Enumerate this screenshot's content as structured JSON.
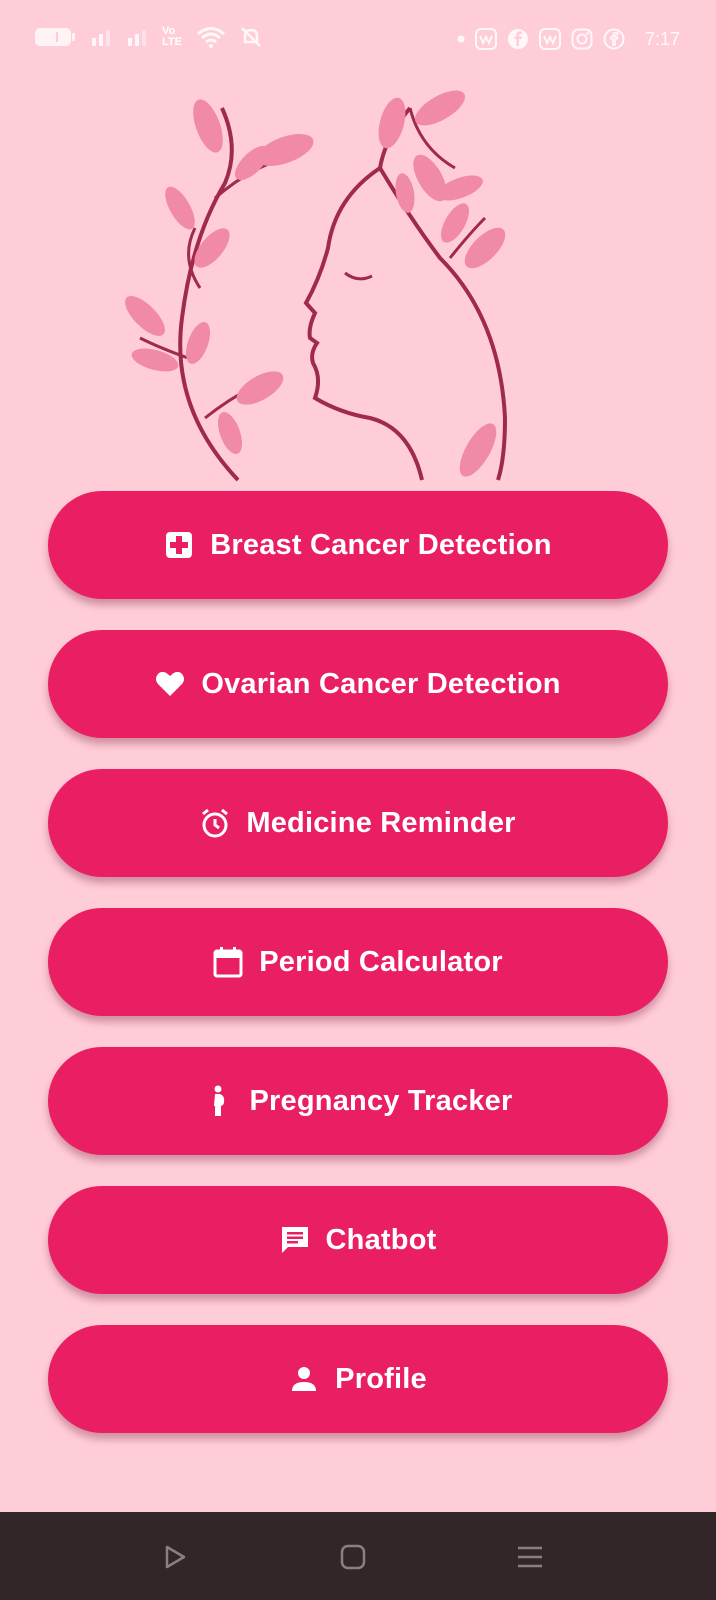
{
  "status_bar": {
    "network_label": "Vo\nLTE",
    "time": "7:17",
    "icons": [
      "battery-icon",
      "signal-icon",
      "signal-icon",
      "volte-icon",
      "wifi-icon",
      "mute-icon",
      "dot-icon",
      "app-icon",
      "facebook-icon",
      "app-icon",
      "instagram-icon",
      "facebook-icon"
    ]
  },
  "hero": {
    "image": "woman-profile-leaves-illustration",
    "colors": {
      "line": "#a0294f",
      "leaf": "#f08aa6"
    }
  },
  "menu": {
    "accent": "#e91e63",
    "items": [
      {
        "label": "Breast Cancer Detection",
        "icon": "medical-cross-icon"
      },
      {
        "label": "Ovarian Cancer Detection",
        "icon": "heart-icon"
      },
      {
        "label": "Medicine Reminder",
        "icon": "alarm-clock-icon"
      },
      {
        "label": "Period Calculator",
        "icon": "calendar-icon"
      },
      {
        "label": "Pregnancy Tracker",
        "icon": "pregnant-woman-icon"
      },
      {
        "label": "Chatbot",
        "icon": "chat-icon"
      },
      {
        "label": "Profile",
        "icon": "person-icon"
      }
    ]
  },
  "nav_bar": {
    "buttons": [
      "back-icon",
      "home-icon",
      "recents-icon"
    ]
  }
}
